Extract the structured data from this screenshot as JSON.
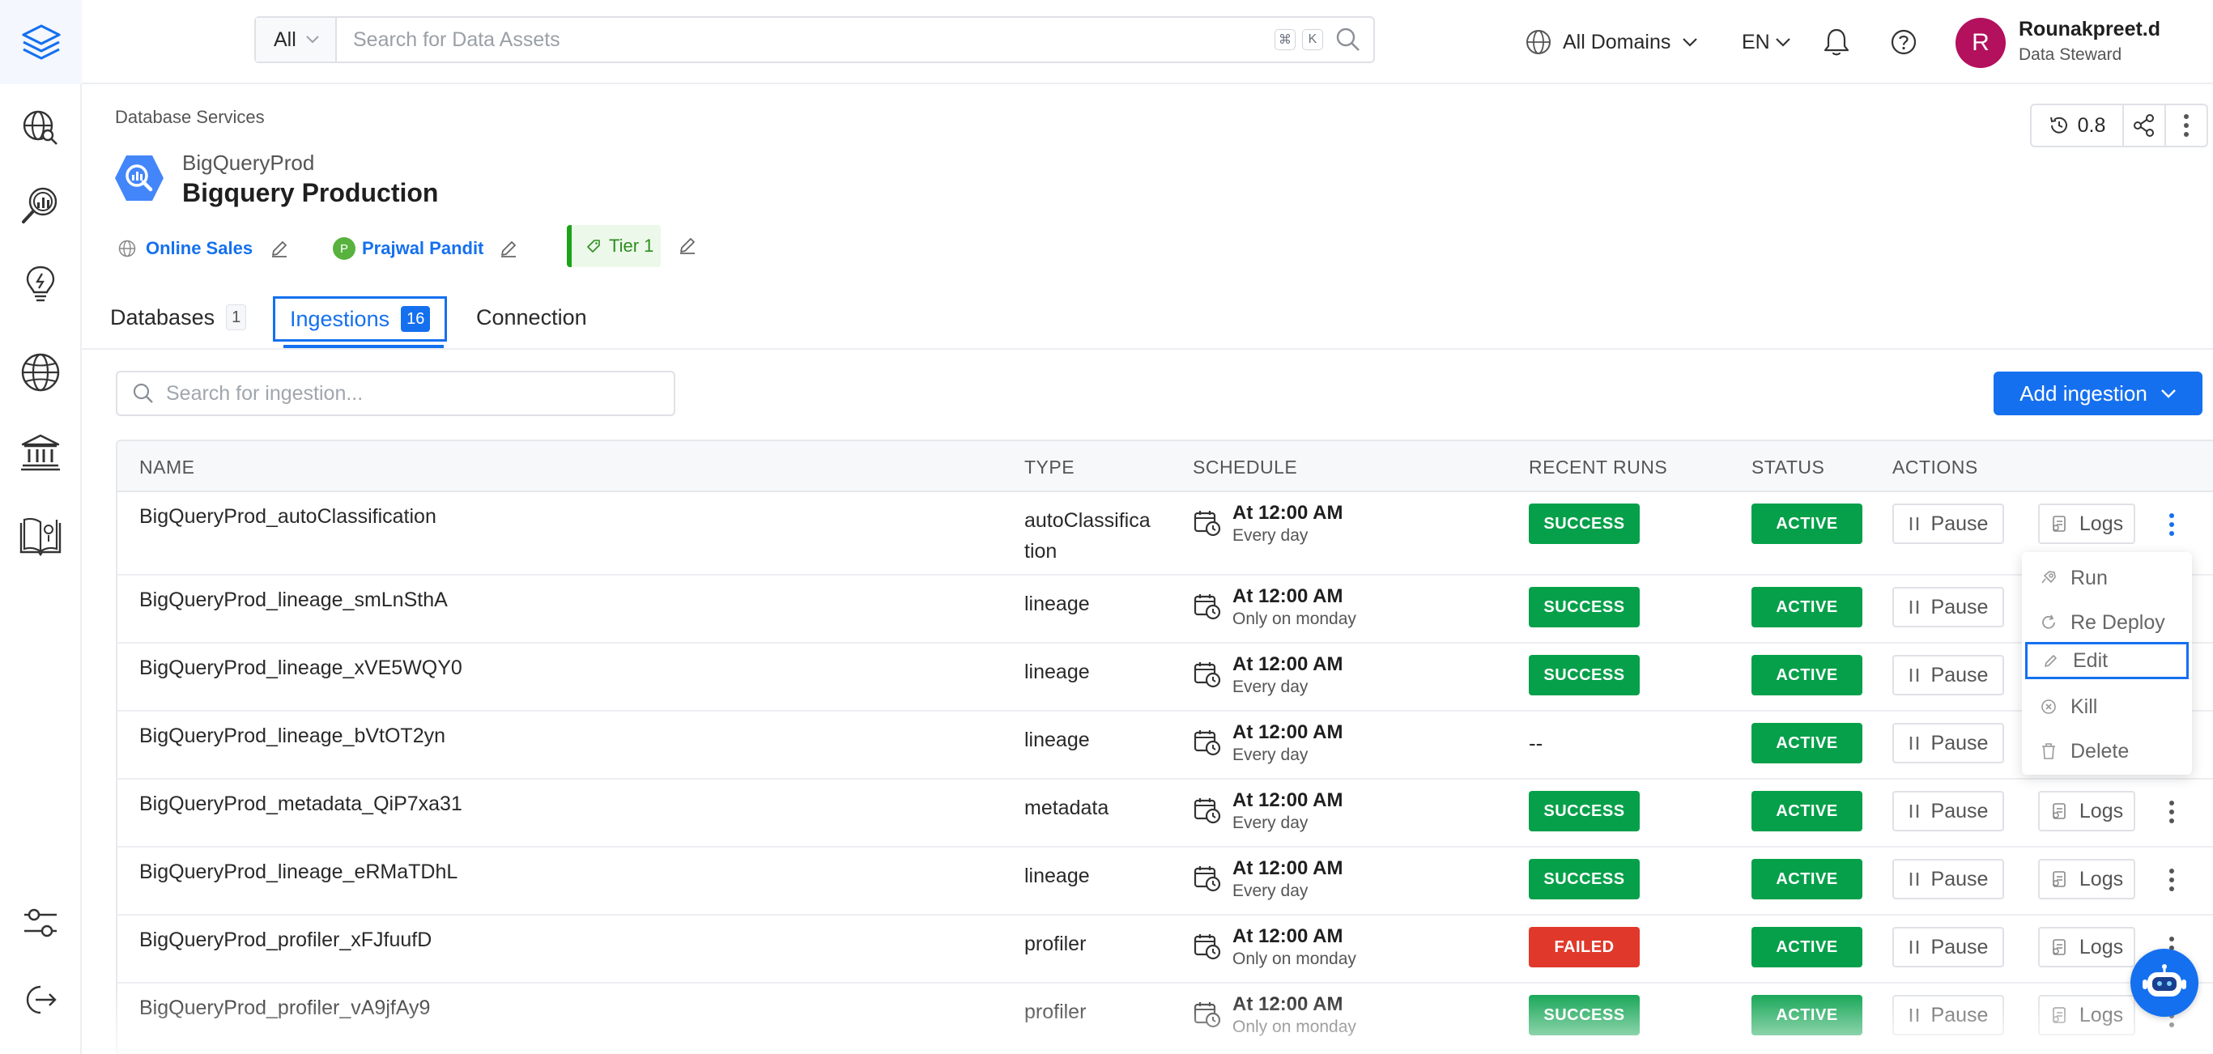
{
  "app": {
    "brand_color": "#1570ef",
    "logo_icon": "layers-logo-icon"
  },
  "sidebar": {
    "items": [
      {
        "name": "explore-icon"
      },
      {
        "name": "observability-icon"
      },
      {
        "name": "insights-icon"
      },
      {
        "name": "domains-icon"
      },
      {
        "name": "governance-icon"
      },
      {
        "name": "glossary-icon"
      },
      {
        "name": "settings-icon"
      },
      {
        "name": "logout-icon"
      }
    ]
  },
  "header": {
    "search_filter": "All",
    "search_placeholder": "Search for Data Assets",
    "shortcut_cmd": "⌘",
    "shortcut_key": "K",
    "domain_label": "All Domains",
    "language": "EN",
    "user": {
      "initial": "R",
      "name": "Rounakpreet.d",
      "role": "Data Steward",
      "avatar_color": "#b3105d"
    }
  },
  "service": {
    "breadcrumb": "Database Services",
    "name": "BigQueryProd",
    "display_name": "Bigquery Production",
    "version": "0.8",
    "domain": "Online Sales",
    "owner_initial": "P",
    "owner": "Prajwal Pandit",
    "tier": "Tier 1"
  },
  "tabs": [
    {
      "label": "Databases",
      "count": "1"
    },
    {
      "label": "Ingestions",
      "count": "16"
    },
    {
      "label": "Connection"
    }
  ],
  "ingestions": {
    "search_placeholder": "Search for ingestion...",
    "add_button": "Add ingestion",
    "columns": [
      "NAME",
      "TYPE",
      "SCHEDULE",
      "RECENT RUNS",
      "STATUS",
      "ACTIONS"
    ],
    "pause_label": "Pause",
    "logs_label": "Logs",
    "rows": [
      {
        "name": "BigQueryProd_autoClassification",
        "type_line1": "autoClassifica",
        "type_line2": "tion",
        "schedule": "At 12:00 AM",
        "frequency": "Every day",
        "recent": "SUCCESS",
        "status": "ACTIVE"
      },
      {
        "name": "BigQueryProd_lineage_smLnSthA",
        "type_line1": "lineage",
        "type_line2": "",
        "schedule": "At 12:00 AM",
        "frequency": "Only on monday",
        "recent": "SUCCESS",
        "status": "ACTIVE"
      },
      {
        "name": "BigQueryProd_lineage_xVE5WQY0",
        "type_line1": "lineage",
        "type_line2": "",
        "schedule": "At 12:00 AM",
        "frequency": "Every day",
        "recent": "SUCCESS",
        "status": "ACTIVE"
      },
      {
        "name": "BigQueryProd_lineage_bVtOT2yn",
        "type_line1": "lineage",
        "type_line2": "",
        "schedule": "At 12:00 AM",
        "frequency": "Every day",
        "recent": "--",
        "status": "ACTIVE"
      },
      {
        "name": "BigQueryProd_metadata_QiP7xa31",
        "type_line1": "metadata",
        "type_line2": "",
        "schedule": "At 12:00 AM",
        "frequency": "Every day",
        "recent": "SUCCESS",
        "status": "ACTIVE"
      },
      {
        "name": "BigQueryProd_lineage_eRMaTDhL",
        "type_line1": "lineage",
        "type_line2": "",
        "schedule": "At 12:00 AM",
        "frequency": "Every day",
        "recent": "SUCCESS",
        "status": "ACTIVE"
      },
      {
        "name": "BigQueryProd_profiler_xFJfuufD",
        "type_line1": "profiler",
        "type_line2": "",
        "schedule": "At 12:00 AM",
        "frequency": "Only on monday",
        "recent": "FAILED",
        "status": "ACTIVE"
      },
      {
        "name": "BigQueryProd_profiler_vA9jfAy9",
        "type_line1": "profiler",
        "type_line2": "",
        "schedule": "At 12:00 AM",
        "frequency": "Only on monday",
        "recent": "SUCCESS",
        "status": "ACTIVE"
      }
    ]
  },
  "row_menu": {
    "items": [
      {
        "label": "Run",
        "icon": "run-icon"
      },
      {
        "label": "Re Deploy",
        "icon": "redeploy-icon"
      },
      {
        "label": "Edit",
        "icon": "edit-icon"
      },
      {
        "label": "Kill",
        "icon": "kill-icon"
      },
      {
        "label": "Delete",
        "icon": "delete-icon"
      }
    ]
  }
}
